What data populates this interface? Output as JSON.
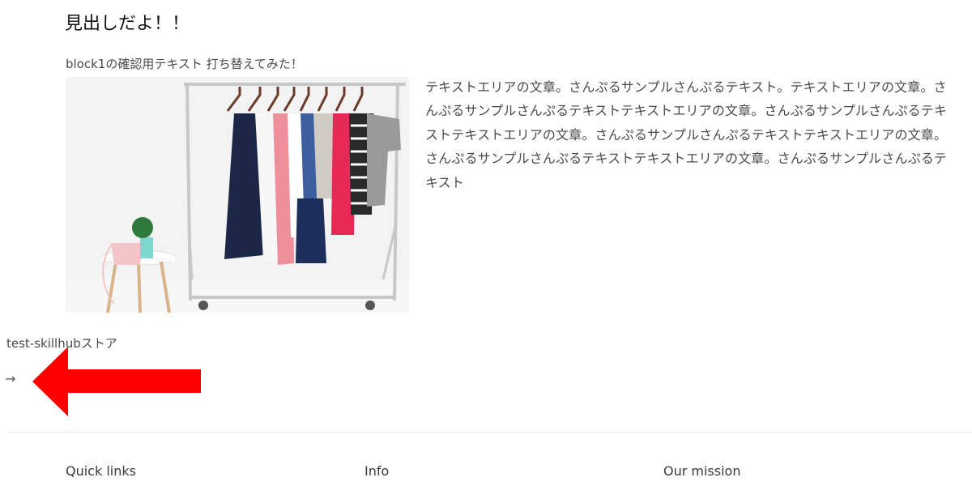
{
  "section": {
    "heading": "見出しだよ！！",
    "caption": "block1の確認用テキスト 打ち替えてみた！",
    "body_text": "テキストエリアの文章。さんぷるサンプルさんぷるテキスト。テキストエリアの文章。さんぷるサンプルさんぷるテキストテキストエリアの文章。さんぷるサンプルさんぷるテキストテキストエリアの文章。さんぷるサンプルさんぷるテキストテキストエリアの文章。さんぷるサンプルさんぷるテキストテキストエリアの文章。さんぷるサンプルさんぷるテキスト"
  },
  "store": {
    "name": "test-skillhubストア",
    "arrow_glyph": "→",
    "arrow_icon": "arrow-right-icon"
  },
  "annotation": {
    "icon": "red-arrow-left-icon",
    "color": "#ff0000"
  },
  "footer": {
    "headings": [
      "Quick links",
      "Info",
      "Our mission"
    ]
  }
}
